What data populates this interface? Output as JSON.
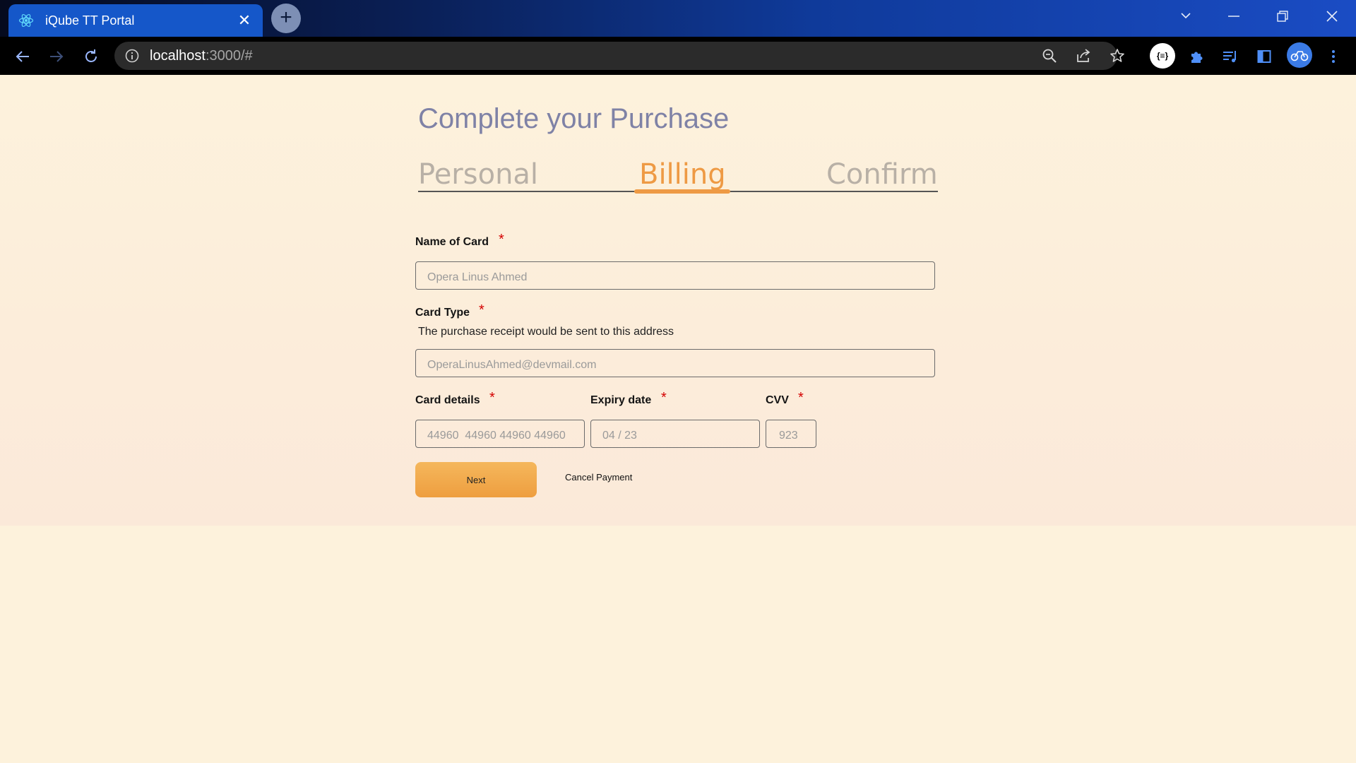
{
  "browser": {
    "tab_title": "iQube TT Portal",
    "url_host": "localhost",
    "url_rest": ":3000/#",
    "extension_badge": "{≡}"
  },
  "page": {
    "title": "Complete your Purchase",
    "steps": [
      {
        "label": "Personal",
        "active": false
      },
      {
        "label": "Billing",
        "active": true
      },
      {
        "label": "Confirm",
        "active": false
      }
    ],
    "accent_color": "#ee9a44"
  },
  "form": {
    "name_of_card": {
      "label": "Name of Card",
      "required": "*",
      "placeholder": "Opera Linus Ahmed"
    },
    "card_type": {
      "label": "Card Type",
      "required": "*",
      "helper": "The purchase receipt would be sent to this address",
      "placeholder": "OperaLinusAhmed@devmail.com"
    },
    "card_details": {
      "label": "Card details",
      "required": "*",
      "placeholder": "44960  44960 44960 44960"
    },
    "expiry_date": {
      "label": "Expiry date",
      "required": "*",
      "placeholder": "04 / 23"
    },
    "cvv": {
      "label": "CVV",
      "required": "*",
      "placeholder": "923"
    },
    "next_label": "Next",
    "cancel_label": "Cancel Payment"
  }
}
